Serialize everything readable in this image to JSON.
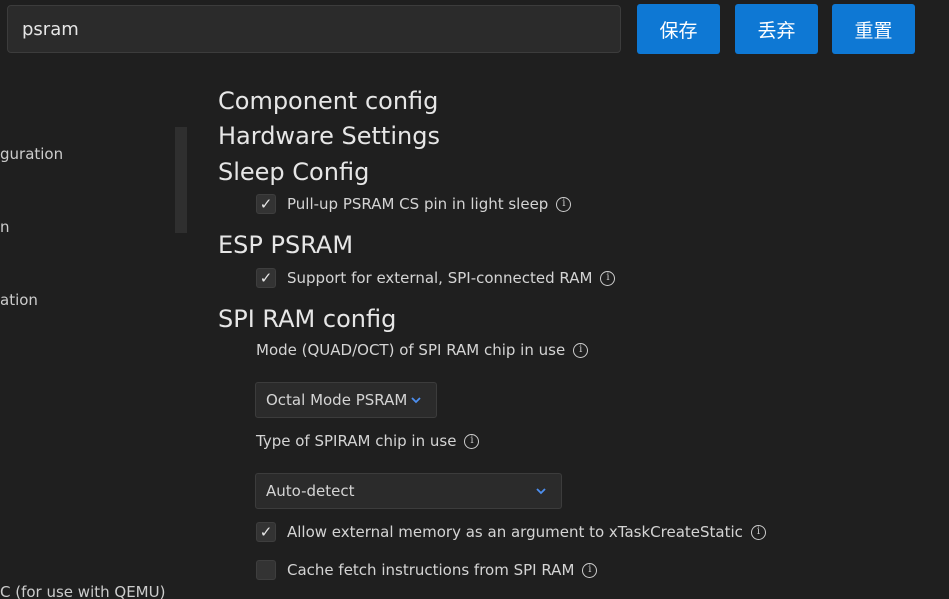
{
  "search": {
    "value": "psram",
    "placeholder": ""
  },
  "toolbar": {
    "save_label": "保存",
    "discard_label": "丢弃",
    "reset_label": "重置"
  },
  "sidebar": {
    "items": [
      {
        "label": "guration"
      },
      {
        "label": "n"
      },
      {
        "label": "ation"
      },
      {
        "label": "C (for use with QEMU)"
      }
    ]
  },
  "main": {
    "headings": {
      "component": "Component config",
      "hardware": "Hardware Settings",
      "sleep": "Sleep Config",
      "esp_psram": "ESP PSRAM",
      "spi_ram": "SPI RAM config"
    },
    "options": {
      "pullup_cs": {
        "label": "Pull-up PSRAM CS pin in light sleep",
        "checked": true
      },
      "support_ext": {
        "label": "Support for external, SPI-connected RAM",
        "checked": true
      },
      "mode_label": "Mode (QUAD/OCT) of SPI RAM chip in use",
      "mode_value": "Octal Mode PSRAM",
      "type_label": "Type of SPIRAM chip in use",
      "type_value": "Auto-detect",
      "allow_ext_mem": {
        "label": "Allow external memory as an argument to xTaskCreateStatic",
        "checked": true
      },
      "cache_fetch": {
        "label": "Cache fetch instructions from SPI RAM",
        "checked": false
      }
    },
    "check_glyph": "✓",
    "info_glyph": "i"
  },
  "colors": {
    "accent": "#0e78d4",
    "background": "#1f1f1f",
    "text": "#cccccc",
    "chevron": "#4d8ff0"
  }
}
